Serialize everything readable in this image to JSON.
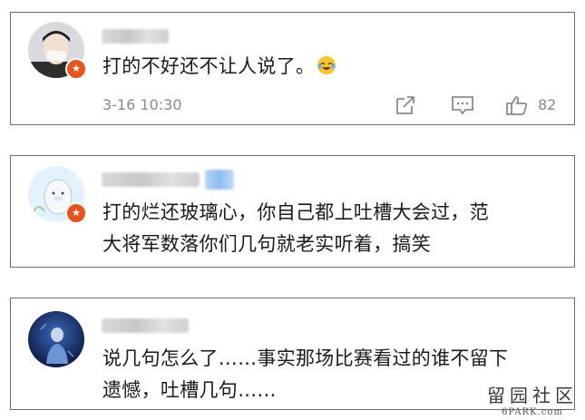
{
  "comments": [
    {
      "text": "打的不好还不让人说了。",
      "emoji": "laughing-tears-emoji",
      "timestamp": "3-16 10:30",
      "likes": "82",
      "badge_icon": "verified-badge-icon"
    },
    {
      "text_line1": "打的烂还玻璃心，你自己都上吐槽大会过，范",
      "text_line2": "大将军数落你们几句就老实听着，搞笑",
      "badge_icon": "verified-badge-icon"
    },
    {
      "text_line1": "说几句怎么了……事实那场比赛看过的谁不留下",
      "text_line2": "遗憾，吐槽几句……"
    }
  ],
  "actions": [
    "share-icon",
    "comment-icon",
    "like-icon"
  ],
  "watermark": {
    "line1": "留园社区",
    "line2": "6PARK.com"
  },
  "colors": {
    "border": "#6b6b6b",
    "meta_text": "#8a8a8a",
    "badge": "#e8541e",
    "body_text": "#1a1a1a"
  }
}
